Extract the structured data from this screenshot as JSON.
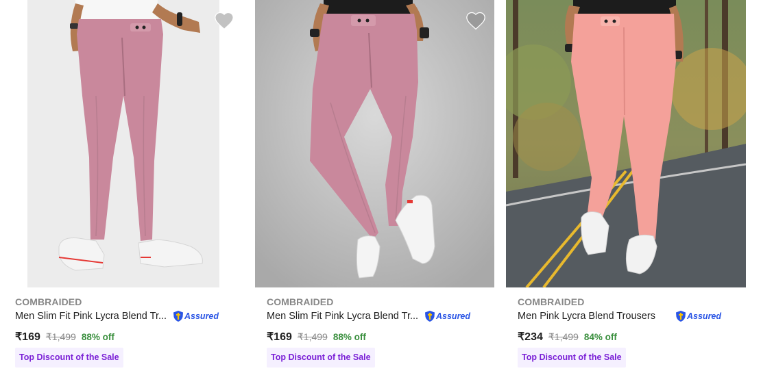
{
  "products": [
    {
      "brand": "COMBRAIDED",
      "title": "Men Slim Fit Pink Lycra Blend Tr...",
      "assured": "Assured",
      "price": "₹169",
      "mrp": "₹1,499",
      "discount": "88% off",
      "tag": "Top Discount of the Sale",
      "icon": "heart-icon"
    },
    {
      "brand": "COMBRAIDED",
      "title": "Men Slim Fit Pink Lycra Blend Tr...",
      "assured": "Assured",
      "price": "₹169",
      "mrp": "₹1,499",
      "discount": "88% off",
      "tag": "Top Discount of the Sale",
      "icon": "heart-icon"
    },
    {
      "brand": "COMBRAIDED",
      "title": "Men Pink Lycra Blend Trousers",
      "assured": "Assured",
      "price": "₹234",
      "mrp": "₹1,499",
      "discount": "84% off",
      "tag": "Top Discount of the Sale",
      "icon": "heart-icon"
    }
  ],
  "colors": {
    "brand_gray": "#878787",
    "discount_green": "#388e3c",
    "assured_blue": "#2a55e5",
    "tag_purple": "#7a1fd6",
    "tag_bg": "#f5f0ff",
    "trouser_pink": "#c9889c",
    "trouser_salmon": "#f4a19a"
  }
}
